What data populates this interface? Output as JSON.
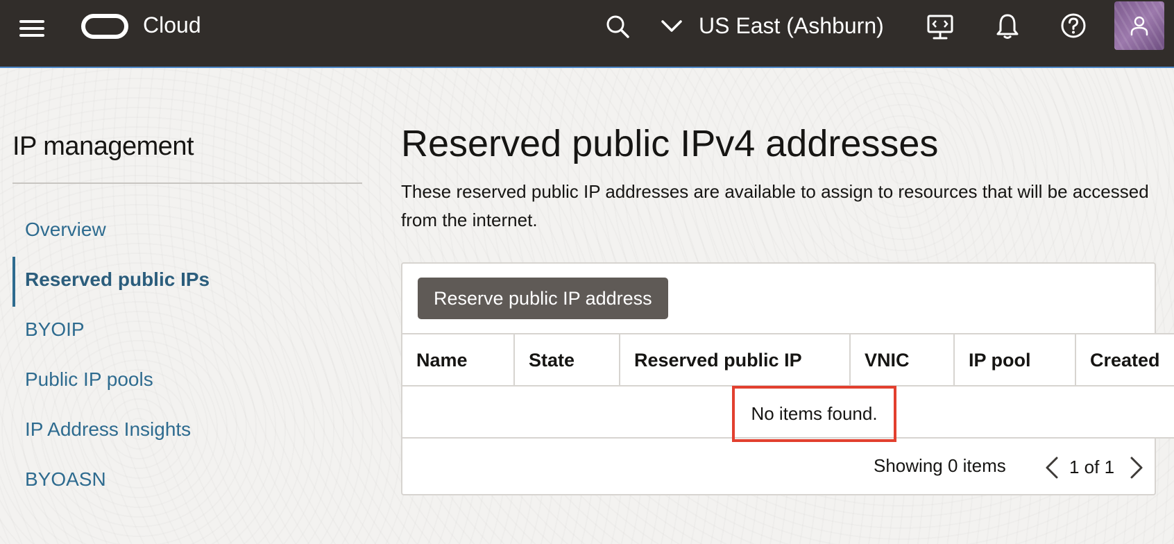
{
  "header": {
    "brand": "Cloud",
    "region": "US East (Ashburn)",
    "icons": [
      "menu-icon",
      "oracle-logo-icon",
      "search-icon",
      "chevron-down-icon",
      "cloud-shell-icon",
      "bell-icon",
      "help-icon",
      "user-icon"
    ]
  },
  "sidebar": {
    "title": "IP management",
    "items": [
      {
        "label": "Overview",
        "active": false
      },
      {
        "label": "Reserved public IPs",
        "active": true
      },
      {
        "label": "BYOIP",
        "active": false
      },
      {
        "label": "Public IP pools",
        "active": false
      },
      {
        "label": "IP Address Insights",
        "active": false
      },
      {
        "label": "BYOASN",
        "active": false
      }
    ]
  },
  "main": {
    "title": "Reserved public IPv4 addresses",
    "description": "These reserved public IP addresses are available to assign to resources that will be accessed from the internet.",
    "actions": {
      "reserve_label": "Reserve public IP address"
    },
    "table": {
      "columns": [
        "Name",
        "State",
        "Reserved public IP",
        "VNIC",
        "IP pool",
        "Created"
      ],
      "empty_message": "No items found.",
      "showing": "Showing 0 items",
      "pagination": "1 of 1"
    }
  },
  "colors": {
    "header_bg": "#312d2a",
    "link": "#2e6b8f",
    "button_bg": "#5f5a56",
    "highlight": "#e2402f"
  }
}
